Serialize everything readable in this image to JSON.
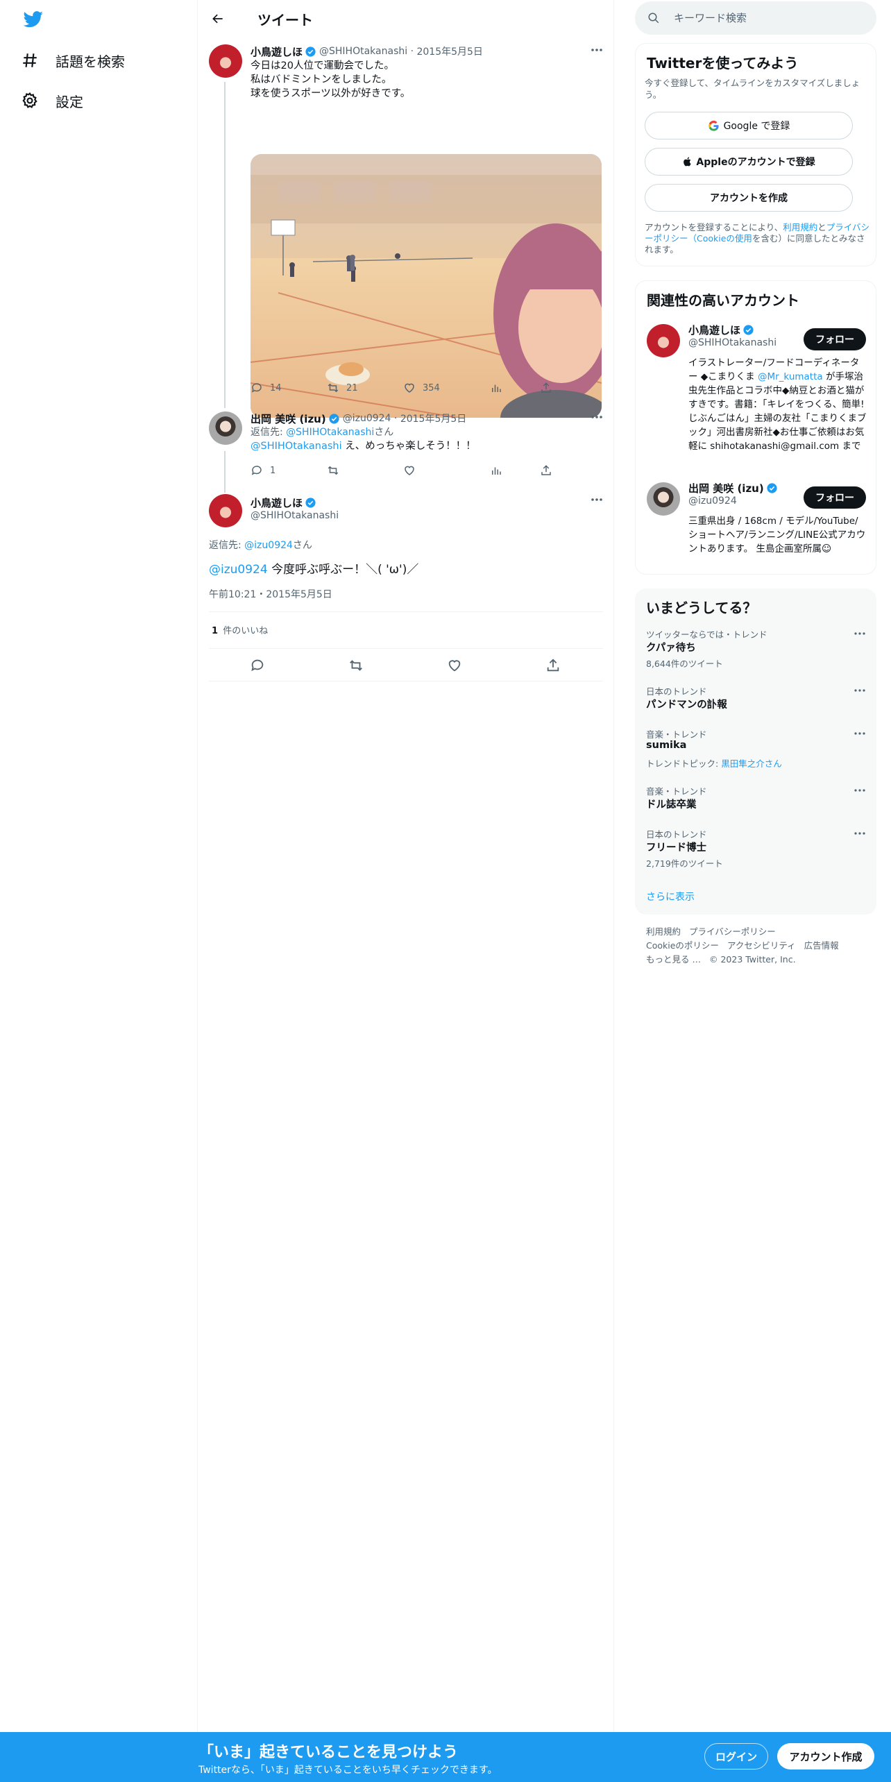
{
  "colors": {
    "accent": "#1d9bf0",
    "text": "#0f1419",
    "muted": "#536471",
    "verified": "#1d9bf0",
    "button_dark": "#0f1419"
  },
  "nav": {
    "logo_icon": "twitter-bird-icon",
    "items": [
      {
        "label": "話題を検索",
        "icon": "hashtag-icon"
      },
      {
        "label": "設定",
        "icon": "gear-icon"
      }
    ]
  },
  "header": {
    "title": "ツイート",
    "back_icon": "arrow-left-icon"
  },
  "tweets": [
    {
      "name": "小鳥遊しほ",
      "handle": "@SHIHOtakanashi",
      "date": "2015年5月5日",
      "text": "今日は20人位で運動会でした。\n私はバドミントンをしました。\n球を使うスポーツ以外が好きです。",
      "has_photo": true,
      "replies": "14",
      "retweets": "21",
      "likes": "354"
    },
    {
      "name": "出岡 美咲 (izu)",
      "handle": "@izu0924",
      "date": "2015年5月5日",
      "reply_prefix": "返信先: ",
      "reply_to": "@SHIHOtakanashi",
      "reply_suffix": "さん",
      "mention": "@SHIHOtakanashi",
      "text": " え、めっちゃ楽しそう！！！",
      "replies": "1"
    }
  ],
  "main_tweet": {
    "name": "小鳥遊しほ",
    "handle": "@SHIHOtakanashi",
    "reply_prefix": "返信先: ",
    "reply_to": "@izu0924",
    "reply_suffix": "さん",
    "mention": "@izu0924",
    "text": " 今度呼ぶ呼ぶー！＼( 'ω')／",
    "timestamp": "午前10:21・2015年5月5日",
    "likes_count": "1",
    "likes_label": "件のいいね"
  },
  "search": {
    "placeholder": "キーワード検索"
  },
  "signup_card": {
    "title": "Twitterを使ってみよう",
    "subtitle": "今すぐ登録して、タイムラインをカスタマイズしましょう。",
    "google_label": "Google で登録",
    "apple_label": "Appleのアカウントで登録",
    "create_label": "アカウントを作成",
    "legal_pre": "アカウントを登録することにより、",
    "legal_terms": "利用規約",
    "legal_and": "と",
    "legal_privacy": "プライバシーポリシー（Cookieの使用",
    "legal_post": "を含む）に同意したとみなされます。"
  },
  "related": {
    "title": "関連性の高いアカウント",
    "follow_label": "フォロー",
    "accounts": [
      {
        "name": "小鳥遊しほ",
        "handle": "@SHIHOtakanashi",
        "bio_1": "イラストレーター/フードコーディネーター ◆こまりくま ",
        "bio_link": "@Mr_kumatta",
        "bio_2": " が手塚治虫先生作品とコラボ中◆納豆とお酒と猫がすきです。書籍：「キレイをつくる、簡単! じぶんごはん」主婦の友社「こまりくまブック」河出書房新社◆お仕事ご依頼はお気軽に shihotakanashi@gmail.com まで"
      },
      {
        "name": "出岡 美咲 (izu)",
        "handle": "@izu0924",
        "bio_1": "三重県出身 / 168cm / モデル/YouTube/ショートヘア/ランニング/LINE公式アカウントあります。 生島企画室所属☺︎",
        "bio_link": "",
        "bio_2": ""
      }
    ]
  },
  "trends": {
    "title": "いまどうしてる？",
    "items": [
      {
        "context": "ツイッターならでは・トレンド",
        "title": "クパァ待ち",
        "sub": "8,644件のツイート"
      },
      {
        "context": "日本のトレンド",
        "title": "パンドマンの訃報",
        "sub": ""
      },
      {
        "context": "音楽・トレンド",
        "title": "sumika",
        "sub_prefix": "トレンドトピック: ",
        "sub_link": "黒田隼之介さん"
      },
      {
        "context": "音楽・トレンド",
        "title": "ドル誌卒業",
        "sub": ""
      },
      {
        "context": "日本のトレンド",
        "title": "フリード博士",
        "sub": "2,719件のツイート"
      }
    ],
    "show_more": "さらに表示"
  },
  "footer": {
    "links": [
      "利用規約",
      "プライバシーポリシー",
      "Cookieのポリシー",
      "アクセシビリティ",
      "広告情報",
      "もっと見る …"
    ],
    "copyright": "© 2023 Twitter, Inc."
  },
  "bottom_bar": {
    "title": "「いま」起きていることを見つけよう",
    "subtitle": "Twitterなら、「いま」起きていることをいち早くチェックできます。",
    "login": "ログイン",
    "signup": "アカウント作成"
  }
}
